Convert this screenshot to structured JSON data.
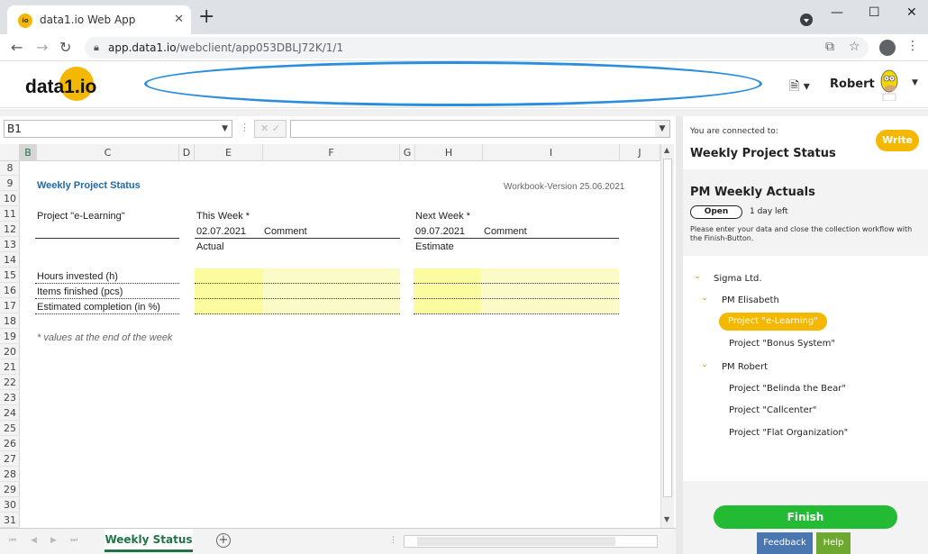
{
  "browser": {
    "tab_title": "data1.io Web App",
    "tab_favicon_text": "io",
    "url_host": "app.data1.io",
    "url_path": "/webclient/app053DBLJ72K/1/1"
  },
  "app": {
    "logo": "data1.io",
    "user_name": "Robert"
  },
  "formula_bar": {
    "cell_ref": "B1",
    "value": ""
  },
  "sheet": {
    "columns": [
      "B",
      "C",
      "D",
      "E",
      "F",
      "G",
      "H",
      "I",
      "J"
    ],
    "rows": [
      "8",
      "9",
      "10",
      "11",
      "12",
      "13",
      "14",
      "15",
      "16",
      "17",
      "18",
      "19",
      "20",
      "21",
      "22",
      "23",
      "24",
      "25",
      "26",
      "27",
      "28",
      "29",
      "30",
      "31"
    ],
    "title": "Weekly Project Status",
    "version": "Workbook-Version 25.06.2021",
    "project_label": "Project \"e-Learning\"",
    "this_week_label": "This Week *",
    "this_week_date": "02.07.2021",
    "this_week_comment": "Comment",
    "this_week_sub": "Actual",
    "next_week_label": "Next Week *",
    "next_week_date": "09.07.2021",
    "next_week_comment": "Comment",
    "next_week_sub": "Estimate",
    "metrics": [
      "Hours invested (h)",
      "Items finished (pcs)",
      "Estimated completion (in %)"
    ],
    "footnote": "* values at the end of the week",
    "active_sheet": "Weekly Status"
  },
  "panel": {
    "connected_label": "You are connected to:",
    "workbook_title": "Weekly Project Status",
    "write_button": "Write",
    "collection_title": "PM Weekly Actuals",
    "status_button": "Open",
    "days_left": "1 day left",
    "instructions": "Please enter your data and close the collection workflow with the Finish-Button.",
    "tree": {
      "root": "Sigma Ltd.",
      "groups": [
        {
          "name": "PM Elisabeth",
          "items": [
            "Project \"e-Learning\"",
            "Project \"Bonus System\""
          ]
        },
        {
          "name": "PM Robert",
          "items": [
            "Project \"Belinda the Bear\"",
            "Project \"Callcenter\"",
            "Project \"Flat Organization\""
          ]
        }
      ]
    },
    "finish_button": "Finish",
    "feedback_button": "Feedback",
    "help_button": "Help"
  },
  "colors": {
    "accent": "#f5b800",
    "finish": "#22bb33",
    "sheet_title": "#1f6aa5",
    "input_yellow": "#fbfba0"
  }
}
